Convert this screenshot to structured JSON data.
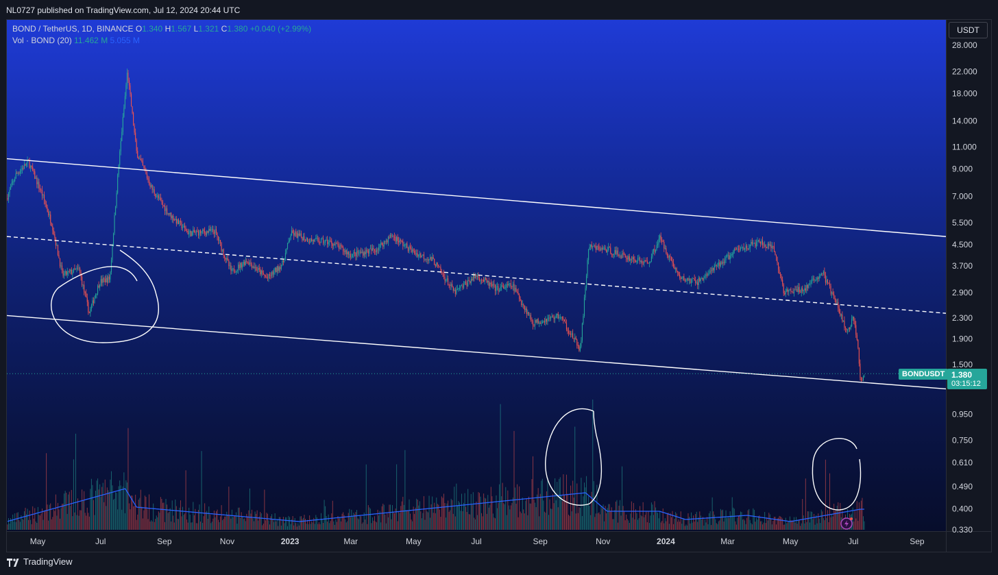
{
  "header": {
    "publish_text": "NL0727 published on TradingView.com, Jul 12, 2024 20:44 UTC"
  },
  "legend": {
    "symbol": "BOND / TetherUS, 1D, BINANCE",
    "o_label": "O",
    "o_value": "1.340",
    "h_label": "H",
    "h_value": "1.567",
    "l_label": "L",
    "l_value": "1.321",
    "c_label": "C",
    "c_value": "1.380",
    "change": "+0.040 (+2.99%)",
    "vol_label": "Vol · BOND (20)",
    "vol_value": "11.462 M",
    "vol_ma_value": "5.055 M"
  },
  "currency": "USDT",
  "last_price": {
    "symbol": "BONDUSDT",
    "value": "1.380",
    "countdown": "03:15:12"
  },
  "footer": {
    "brand": "TradingView"
  },
  "colors": {
    "up": "#26a69a",
    "down": "#ef5350",
    "volume_ma": "#2962ff",
    "drawing": "#ffffff",
    "bg_top": "#1f3bd6",
    "bg_bottom": "#070d2b"
  },
  "icons": [
    "tradingview-logo-icon",
    "flash-icon"
  ],
  "chart_data": {
    "type": "candlestick",
    "title": "BOND / TetherUS, 1D, BINANCE",
    "scale": "log",
    "ylim": [
      0.33,
      28.0
    ],
    "y_ticks": [
      "28.000",
      "22.000",
      "18.000",
      "14.000",
      "11.000",
      "9.000",
      "7.000",
      "5.500",
      "4.500",
      "3.700",
      "2.900",
      "2.300",
      "1.900",
      "1.500",
      "1.200",
      "0.950",
      "0.750",
      "0.610",
      "0.490",
      "0.400",
      "0.330"
    ],
    "x_ticks": [
      "May",
      "Jul",
      "Sep",
      "Nov",
      "2023",
      "Mar",
      "May",
      "Jul",
      "Sep",
      "Nov",
      "2024",
      "Mar",
      "May",
      "Jul",
      "Sep"
    ],
    "price_path": [
      [
        "2022-04-01",
        6.9
      ],
      [
        "2022-04-10",
        8.6
      ],
      [
        "2022-04-22",
        9.6
      ],
      [
        "2022-05-05",
        7.2
      ],
      [
        "2022-05-15",
        5.4
      ],
      [
        "2022-05-25",
        3.4
      ],
      [
        "2022-06-10",
        3.6
      ],
      [
        "2022-06-20",
        2.4
      ],
      [
        "2022-06-30",
        3.2
      ],
      [
        "2022-07-10",
        3.3
      ],
      [
        "2022-07-18",
        8.8
      ],
      [
        "2022-07-27",
        22.0
      ],
      [
        "2022-08-05",
        10.5
      ],
      [
        "2022-08-20",
        7.5
      ],
      [
        "2022-09-05",
        6.0
      ],
      [
        "2022-09-25",
        5.0
      ],
      [
        "2022-10-20",
        5.1
      ],
      [
        "2022-11-05",
        3.5
      ],
      [
        "2022-11-20",
        3.9
      ],
      [
        "2022-12-10",
        3.3
      ],
      [
        "2022-12-25",
        3.8
      ],
      [
        "2023-01-02",
        5.0
      ],
      [
        "2023-01-20",
        4.7
      ],
      [
        "2023-02-10",
        4.6
      ],
      [
        "2023-03-01",
        4.1
      ],
      [
        "2023-03-25",
        4.3
      ],
      [
        "2023-04-10",
        4.9
      ],
      [
        "2023-05-01",
        4.2
      ],
      [
        "2023-05-20",
        3.9
      ],
      [
        "2023-06-10",
        2.9
      ],
      [
        "2023-07-01",
        3.4
      ],
      [
        "2023-07-20",
        3.0
      ],
      [
        "2023-08-05",
        3.1
      ],
      [
        "2023-08-25",
        2.2
      ],
      [
        "2023-09-20",
        2.35
      ],
      [
        "2023-10-10",
        1.72
      ],
      [
        "2023-10-18",
        4.4
      ],
      [
        "2023-11-05",
        4.3
      ],
      [
        "2023-11-25",
        4.0
      ],
      [
        "2023-12-15",
        3.8
      ],
      [
        "2023-12-26",
        4.8
      ],
      [
        "2024-01-15",
        3.3
      ],
      [
        "2024-02-01",
        3.2
      ],
      [
        "2024-02-20",
        3.7
      ],
      [
        "2024-03-10",
        4.3
      ],
      [
        "2024-04-01",
        4.6
      ],
      [
        "2024-04-15",
        4.3
      ],
      [
        "2024-04-25",
        2.9
      ],
      [
        "2024-05-15",
        3.0
      ],
      [
        "2024-06-01",
        3.5
      ],
      [
        "2024-06-15",
        2.6
      ],
      [
        "2024-06-25",
        2.0
      ],
      [
        "2024-07-01",
        2.3
      ],
      [
        "2024-07-05",
        1.9
      ],
      [
        "2024-07-08",
        1.3
      ],
      [
        "2024-07-12",
        1.38
      ]
    ],
    "volume_path": [
      [
        "2022-04-01",
        0.2
      ],
      [
        "2022-07-25",
        1.0
      ],
      [
        "2022-08-05",
        0.55
      ],
      [
        "2023-01-10",
        0.2
      ],
      [
        "2023-10-15",
        0.9
      ],
      [
        "2023-11-05",
        0.45
      ],
      [
        "2023-12-26",
        0.45
      ],
      [
        "2024-01-20",
        0.25
      ],
      [
        "2024-03-20",
        0.35
      ],
      [
        "2024-05-01",
        0.2
      ],
      [
        "2024-07-08",
        0.5
      ]
    ],
    "drawings": {
      "channel_upper": [
        [
          "2022-04-01",
          9.9
        ],
        [
          "2024-09-29",
          4.85
        ]
      ],
      "channel_mid_dashed": [
        [
          "2022-04-01",
          4.85
        ],
        [
          "2024-09-29",
          2.4
        ]
      ],
      "channel_lower": [
        [
          "2022-04-01",
          2.35
        ],
        [
          "2024-09-29",
          1.2
        ]
      ]
    }
  }
}
